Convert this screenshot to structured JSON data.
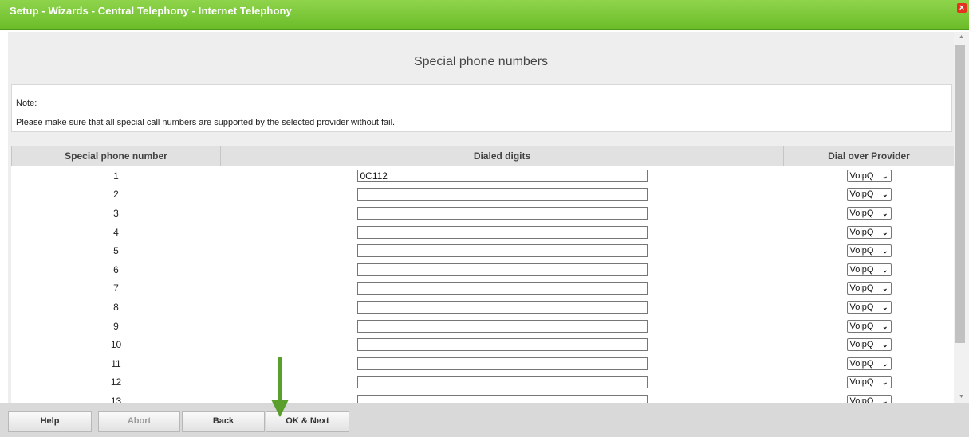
{
  "window": {
    "title": "Setup - Wizards - Central Telephony - Internet Telephony",
    "close_icon": "close-icon",
    "close_glyph": "×"
  },
  "page": {
    "heading": "Special phone numbers",
    "note_label": "Note:",
    "note_text": "Please make sure that all special call numbers are supported by the selected provider without fail."
  },
  "table": {
    "columns": [
      "Special phone number",
      "Dialed digits",
      "Dial over Provider"
    ],
    "rows": [
      {
        "number": "1",
        "digits": "0C112",
        "provider": "VoipQ"
      },
      {
        "number": "2",
        "digits": "",
        "provider": "VoipQ"
      },
      {
        "number": "3",
        "digits": "",
        "provider": "VoipQ"
      },
      {
        "number": "4",
        "digits": "",
        "provider": "VoipQ"
      },
      {
        "number": "5",
        "digits": "",
        "provider": "VoipQ"
      },
      {
        "number": "6",
        "digits": "",
        "provider": "VoipQ"
      },
      {
        "number": "7",
        "digits": "",
        "provider": "VoipQ"
      },
      {
        "number": "8",
        "digits": "",
        "provider": "VoipQ"
      },
      {
        "number": "9",
        "digits": "",
        "provider": "VoipQ"
      },
      {
        "number": "10",
        "digits": "",
        "provider": "VoipQ"
      },
      {
        "number": "11",
        "digits": "",
        "provider": "VoipQ"
      },
      {
        "number": "12",
        "digits": "",
        "provider": "VoipQ"
      },
      {
        "number": "13",
        "digits": "",
        "provider": "VoipQ"
      }
    ]
  },
  "footer": {
    "help": "Help",
    "abort": "Abort",
    "back": "Back",
    "ok_next": "OK & Next"
  },
  "colors": {
    "title_bar": "#6cbd2a",
    "annotation_arrow": "#5a9e2c"
  },
  "annotation": {
    "icon": "arrow-down-icon"
  }
}
